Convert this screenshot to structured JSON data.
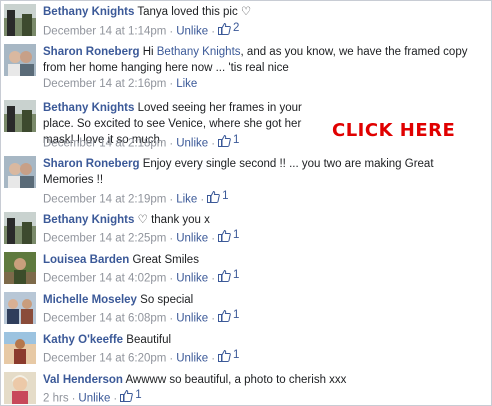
{
  "comments": [
    {
      "author": "Bethany Knights",
      "text": "Tanya loved this pic ♡",
      "time": "December 14 at 1:14pm",
      "action": "Unlike",
      "likes": "2",
      "avatar": "bethany-avatar"
    },
    {
      "author": "Sharon Roneberg",
      "text_before": "Hi",
      "mention": "Bethany Knights",
      "text": ", and as you know, we have the framed copy from her home hanging here now ... 'tis real nice",
      "time": "December 14 at 2:16pm",
      "action": "Like",
      "likes": "",
      "avatar": "sharon-avatar"
    },
    {
      "author": "Bethany Knights",
      "text": "Loved seeing her frames in your place. So excited to see Venice, where she got her mask! I love it so much.",
      "time": "December 14 at 2:18pm",
      "action": "Unlike",
      "likes": "1",
      "avatar": "bethany-avatar"
    },
    {
      "author": "Sharon Roneberg",
      "text": "Enjoy every single second !! ... you two are making Great Memories !!",
      "time": "December 14 at 2:19pm",
      "action": "Like",
      "likes": "1",
      "avatar": "sharon-avatar"
    },
    {
      "author": "Bethany Knights",
      "text": "♡ thank you x",
      "time": "December 14 at 2:25pm",
      "action": "Unlike",
      "likes": "1",
      "avatar": "bethany-avatar"
    },
    {
      "author": "Louisea Barden",
      "text": "Great Smiles",
      "time": "December 14 at 4:02pm",
      "action": "Unlike",
      "likes": "1",
      "avatar": "louisea-avatar"
    },
    {
      "author": "Michelle Moseley",
      "text": "So special",
      "time": "December 14 at 6:08pm",
      "action": "Unlike",
      "likes": "1",
      "avatar": "michelle-avatar"
    },
    {
      "author": "Kathy O'keeffe",
      "text": "Beautiful",
      "time": "December 14 at 6:20pm",
      "action": "Unlike",
      "likes": "1",
      "avatar": "kathy-avatar"
    },
    {
      "author": "Val Henderson",
      "text": "Awwww so beautiful, a photo to cherish xxx",
      "time": "2 hrs",
      "action": "Unlike",
      "likes": "1",
      "avatar": "val-avatar"
    }
  ],
  "overlay": {
    "click_here": "CLICK HERE"
  },
  "colors": {
    "link": "#3b5998",
    "meta": "#90949c",
    "overlay": "#e00000"
  }
}
